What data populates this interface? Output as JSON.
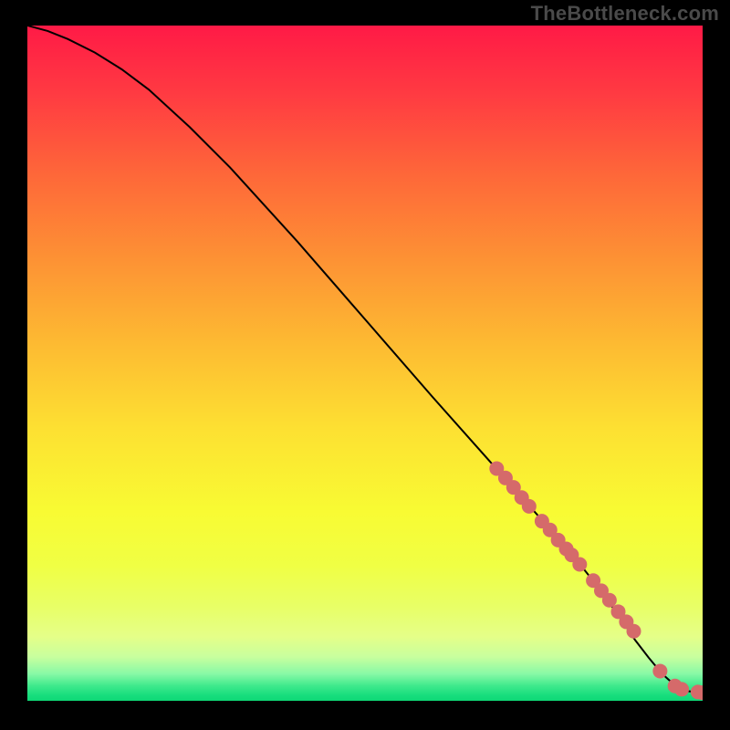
{
  "watermark": "TheBottleneck.com",
  "chart_data": {
    "type": "line",
    "title": "",
    "xlabel": "",
    "ylabel": "",
    "xlim": [
      0,
      100
    ],
    "ylim": [
      0,
      100
    ],
    "grid": false,
    "series": [
      {
        "name": "curve",
        "kind": "line",
        "x": [
          0,
          3,
          6,
          10,
          14,
          18,
          24,
          30,
          40,
          50,
          60,
          68,
          72,
          76,
          80,
          84,
          88,
          90,
          92,
          94,
          96,
          98,
          100
        ],
        "y": [
          100,
          99.2,
          98,
          96,
          93.5,
          90.5,
          85,
          79,
          68,
          56.5,
          45,
          36,
          31.5,
          27,
          22.5,
          17.5,
          12,
          9,
          6.4,
          4,
          2.2,
          1.4,
          1.2
        ]
      },
      {
        "name": "markers",
        "kind": "scatter",
        "x": [
          69.5,
          70.8,
          72.0,
          73.2,
          74.3,
          76.2,
          77.4,
          78.6,
          79.8,
          80.6,
          81.8,
          83.8,
          85.0,
          86.2,
          87.5,
          88.7,
          89.8,
          93.7,
          95.9,
          96.9,
          99.3,
          100.0
        ],
        "y": [
          34.4,
          33.0,
          31.6,
          30.1,
          28.8,
          26.6,
          25.3,
          23.8,
          22.5,
          21.6,
          20.2,
          17.8,
          16.3,
          14.9,
          13.2,
          11.7,
          10.3,
          4.4,
          2.2,
          1.7,
          1.3,
          1.2
        ]
      }
    ],
    "gradient_stops": [
      {
        "offset": 0.0,
        "color": "#ff1a46"
      },
      {
        "offset": 0.1,
        "color": "#ff3a42"
      },
      {
        "offset": 0.22,
        "color": "#fe6739"
      },
      {
        "offset": 0.35,
        "color": "#fd9334"
      },
      {
        "offset": 0.48,
        "color": "#fdbd32"
      },
      {
        "offset": 0.6,
        "color": "#fde132"
      },
      {
        "offset": 0.72,
        "color": "#f8fb33"
      },
      {
        "offset": 0.8,
        "color": "#f0ff44"
      },
      {
        "offset": 0.86,
        "color": "#e8ff66"
      },
      {
        "offset": 0.905,
        "color": "#e5ff88"
      },
      {
        "offset": 0.935,
        "color": "#c8ff9e"
      },
      {
        "offset": 0.96,
        "color": "#88f9a6"
      },
      {
        "offset": 0.978,
        "color": "#3ee98c"
      },
      {
        "offset": 0.992,
        "color": "#17dd7d"
      },
      {
        "offset": 1.0,
        "color": "#0fd876"
      }
    ]
  }
}
